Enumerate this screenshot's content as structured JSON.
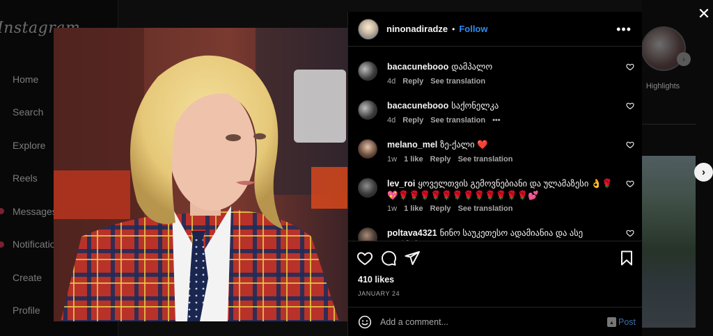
{
  "background": {
    "logo": "Instagram",
    "nav": [
      {
        "label": "Home",
        "icon": "home-icon"
      },
      {
        "label": "Search",
        "icon": "search-icon"
      },
      {
        "label": "Explore",
        "icon": "compass-icon"
      },
      {
        "label": "Reels",
        "icon": "reels-icon"
      },
      {
        "label": "Messages",
        "icon": "messenger-icon"
      },
      {
        "label": "Notifications",
        "icon": "heart-icon"
      },
      {
        "label": "Create",
        "icon": "plus-square-icon"
      },
      {
        "label": "Profile",
        "icon": "avatar-icon"
      }
    ],
    "highlight_label": "Highlights"
  },
  "post": {
    "username": "ninonadiradze",
    "follow_label": "Follow",
    "more_icon": "more-horizontal-icon",
    "likes": "410 likes",
    "date": "JANUARY 24"
  },
  "comments": [
    {
      "user": "bacacunebooo",
      "text": "დამპალო",
      "time": "4d",
      "likes": "",
      "reply": "Reply",
      "translate": "See translation",
      "more": false
    },
    {
      "user": "bacacunebooo",
      "text": "საქონელკა",
      "time": "4d",
      "likes": "",
      "reply": "Reply",
      "translate": "See translation",
      "more": true
    },
    {
      "user": "melano_mel",
      "text": "ზე-ქალი ❤️",
      "time": "1w",
      "likes": "1 like",
      "reply": "Reply",
      "translate": "See translation",
      "more": false
    },
    {
      "user": "lev_roi",
      "text": "ყოველთვის გემოვნებიანი და ულამაზესი 👌🌹💖🌹🌹🌹🌹🌹🌹🌹🌹🌹🌹🌹🌹💕",
      "time": "1w",
      "likes": "1 like",
      "reply": "Reply",
      "translate": "See translation",
      "more": false
    },
    {
      "user": "poltava4321",
      "text": "ნინო საუკეთესო ადამიანია და ასე დარჩება",
      "time": "",
      "likes": "",
      "reply": "",
      "translate": "",
      "more": false
    }
  ],
  "add_comment": {
    "placeholder": "Add a comment...",
    "post_label": "Post"
  },
  "colors": {
    "accent": "#2b8cf5",
    "post_button": "#3d6fa8",
    "background": "#000000"
  }
}
